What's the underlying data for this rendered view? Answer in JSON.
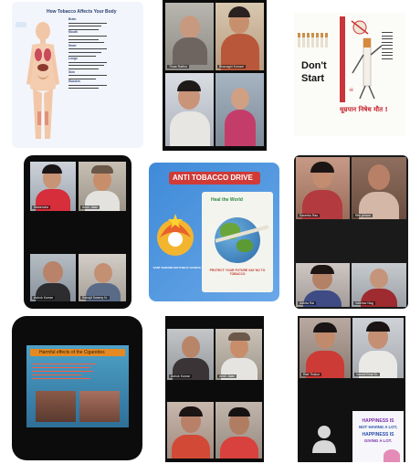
{
  "tile1": {
    "title": "How Tobacco Affects Your Body",
    "headings": [
      "Brain",
      "Mouth",
      "Heart",
      "Lungs",
      "Skin",
      "Muscles"
    ]
  },
  "tile2": {
    "names": [
      "Tinaa Rathor",
      "Bhavaghi Kumari"
    ]
  },
  "tile3": {
    "words": [
      "Don't",
      "Start"
    ],
    "slogan": "धूम्रपान निषेध मौत !"
  },
  "tile4": {
    "names": [
      "Mahendra",
      "Ansh Jalan",
      "Ashok Kumar",
      "Sahajit Swamy N."
    ]
  },
  "tile5": {
    "title": "ANTI TOBACCO DRIVE",
    "brand": "Heal the World",
    "school": "SANT NARANKARI PUBLIC SCHOOL",
    "caption": "PROTECT YOUR FUTURE SAY NO TO TOBACCO"
  },
  "tile6": {
    "names": [
      "Saveetu Rao",
      "Ritu jeham",
      "Adhita Rai",
      "Vaibhav Nag"
    ]
  },
  "tile7": {
    "title": "Harmful effects of the Cigarettes"
  },
  "tile8": {
    "names": [
      "Ashok Kumar",
      "Ansh Jalan"
    ]
  },
  "tile9": {
    "names": [
      "Rati Thakur",
      "Vanshi Bhat Sr."
    ],
    "quote": [
      "HAPPINESS IS",
      "NOT HAVING A LOT,",
      "HAPPINESS IS",
      "GIVING A LOT."
    ]
  },
  "colors": {
    "accent_blue": "#2b66a8",
    "video_bg": "#0c0c0c",
    "tile_border": "#151515"
  }
}
